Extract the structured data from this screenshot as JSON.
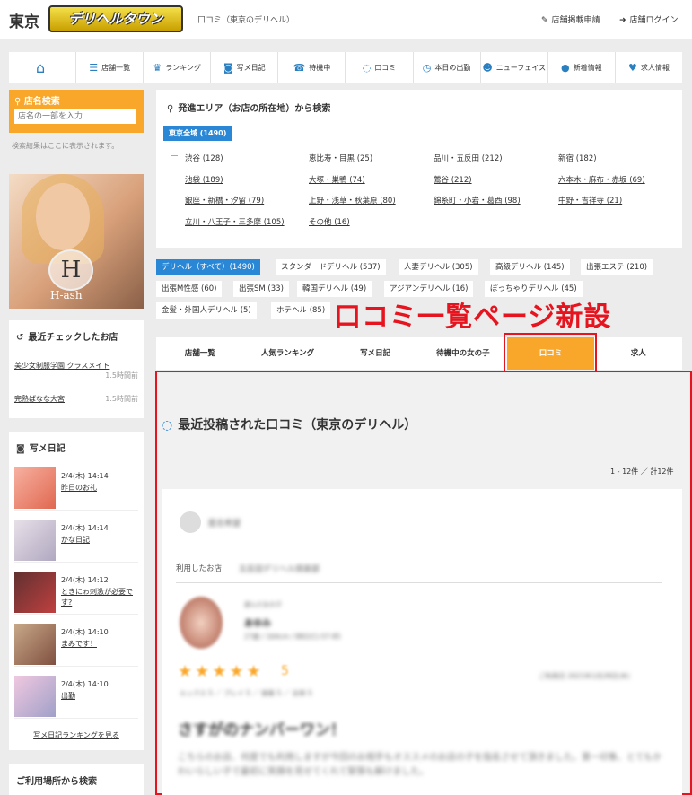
{
  "header": {
    "logo_prefix": "東京",
    "logo_text": "デリヘルタウン",
    "subtitle": "口コミ（東京のデリヘル）",
    "shop_apply": "店舗掲載申請",
    "shop_login": "店舗ログイン"
  },
  "nav": [
    {
      "icon": "home-icon",
      "label": ""
    },
    {
      "icon": "list-icon",
      "label": "店舗一覧"
    },
    {
      "icon": "crown-icon",
      "label": "ランキング"
    },
    {
      "icon": "camera-icon",
      "label": "写メ日記"
    },
    {
      "icon": "phone-icon",
      "label": "待機中"
    },
    {
      "icon": "chat-icon",
      "label": "口コミ"
    },
    {
      "icon": "clock-icon",
      "label": "本日の出勤"
    },
    {
      "icon": "face-icon",
      "label": "ニューフェイス"
    },
    {
      "icon": "new-icon",
      "label": "新着情報"
    },
    {
      "icon": "heart-icon",
      "label": "求人情報"
    }
  ],
  "sidebar": {
    "search_title": "店名検索",
    "search_placeholder": "店名の一部を入力",
    "search_note": "検索結果はここに表示されます。",
    "banner_text": "H-ash",
    "recent_title": "最近チェックしたお店",
    "recent": [
      {
        "name": "美少女制服学園 クラスメイト",
        "time": "1.5時間前"
      },
      {
        "name": "完熟ばなな大宮",
        "time": "1.5時間前"
      }
    ],
    "photo_title": "写メ日記",
    "photos": [
      {
        "date": "2/4(木) 14:14",
        "title": "昨日のお礼"
      },
      {
        "date": "2/4(木) 14:14",
        "title": "かな日記"
      },
      {
        "date": "2/4(木) 14:12",
        "title": "ときにゎ刺激が必要です?"
      },
      {
        "date": "2/4(木) 14:10",
        "title": "まみです！"
      },
      {
        "date": "2/4(木) 14:10",
        "title": "出勤"
      }
    ],
    "photo_more": "写メ日記ランキングを見る",
    "use_title": "ご利用場所から検索"
  },
  "area": {
    "title": "発進エリア（お店の所在地）から検索",
    "all": "東京全域 (1490)",
    "links": [
      "渋谷 (128)",
      "恵比寿・目黒 (25)",
      "品川・五反田 (212)",
      "新宿 (182)",
      "池袋 (189)",
      "大塚・巣鴨 (74)",
      "鶯谷 (212)",
      "六本木・麻布・赤坂 (69)",
      "銀座・新橋・汐留 (79)",
      "上野・浅草・秋葉原 (80)",
      "錦糸町・小岩・葛西 (98)",
      "中野・吉祥寺 (21)",
      "立川・八王子・三多摩 (105)",
      "その他 (16)"
    ]
  },
  "categories": [
    "デリヘル（すべて）(1490)",
    "スタンダードデリヘル (537)",
    "人妻デリヘル (305)",
    "高級デリヘル (145)",
    "出張エステ (210)",
    "出張M性感 (60)",
    "出張SM (33)",
    "韓国デリヘル (49)",
    "アジアンデリヘル (16)",
    "ぽっちゃりデリヘル (45)",
    "金髪・外国人デリヘル (5)",
    "ホテヘル (85)"
  ],
  "promo": "口コミ一覧ページ新設",
  "tabs": [
    "店舗一覧",
    "人気ランキング",
    "写メ日記",
    "待機中の女の子",
    "口コミ",
    "求人"
  ],
  "review": {
    "title": "最近投稿された口コミ（東京のデリヘル）",
    "count": "1 - 12件 ／ 計12件",
    "user": "匿名希望",
    "shop_label": "利用したお店",
    "shop_name": "五反田デリヘル倶楽部",
    "girl_meta": "遊んだ女の子",
    "girl_name": "あゆみ",
    "girl_stats": "27歳 / 164cm / B82(C)-57-85",
    "score": "5",
    "date": "ご利用日 2021年1月28日(木)",
    "sub_scores": "ルックス 5 ／ プレイ 5 ／ 接客 5 ／ 全体 5",
    "headline": "さすがのナンバーワン！",
    "body": "こちらのお店、何度でも利用しますが今回のお相手もオススメのお店の子を指名させて頂きました。第一印象、とてもかわいらしい子で最初に笑顔を見せてくれて緊張も解けました。"
  }
}
